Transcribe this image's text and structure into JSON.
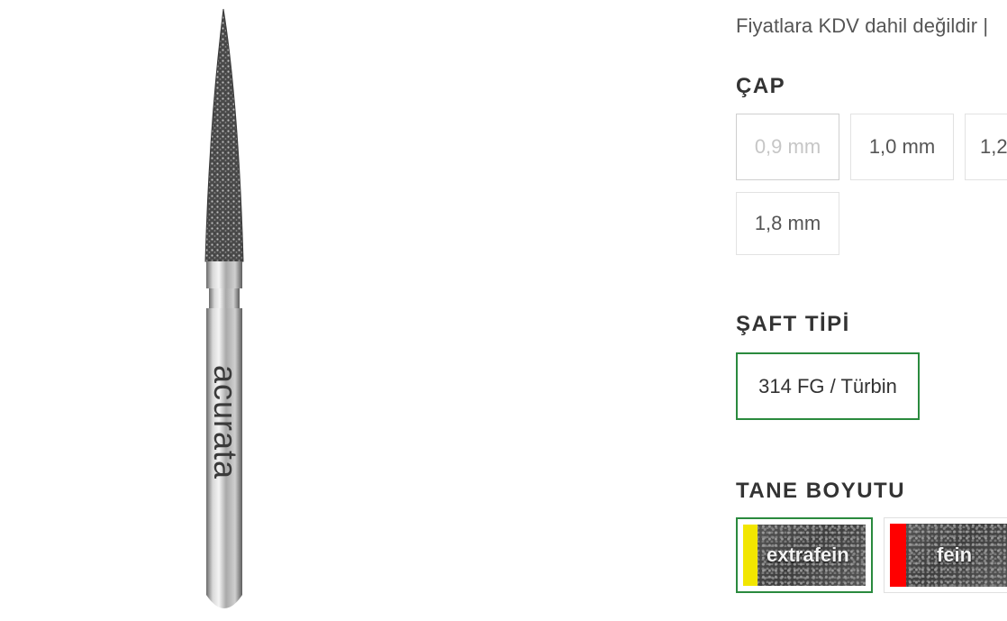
{
  "product": {
    "image_alt": "Diamond bur",
    "brand_engraving": "acurata"
  },
  "tax_note": "Fiyatlara KDV dahil değildir |",
  "diameter": {
    "title": "ÇAP",
    "options": [
      {
        "label": "0,9 mm",
        "state": "disabled"
      },
      {
        "label": "1,0 mm",
        "state": "available"
      },
      {
        "label": "1,2",
        "state": "available"
      },
      {
        "label": "1,8 mm",
        "state": "available"
      }
    ]
  },
  "shaft": {
    "title": "ŞAFT TİPİ",
    "options": [
      {
        "label": "314 FG / Türbin",
        "state": "selected"
      }
    ]
  },
  "grain": {
    "title": "TANE BOYUTU",
    "options": [
      {
        "label": "extrafein",
        "stripe_color": "#f2e600",
        "state": "selected"
      },
      {
        "label": "fein",
        "stripe_color": "#ff0000",
        "state": "available"
      }
    ]
  }
}
